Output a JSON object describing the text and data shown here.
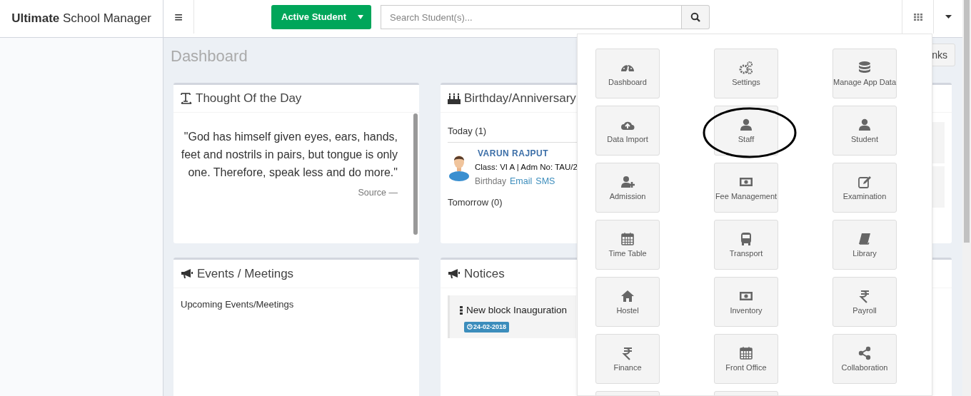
{
  "brand": {
    "bold": "Ultimate",
    "rest": "School Manager"
  },
  "header": {
    "menu_glyph": "≡",
    "status_button": "Active Student",
    "search": {
      "placeholder": "Search Student(s)..."
    }
  },
  "page_title": "Dashboard",
  "quick_button": "nks",
  "thought": {
    "title": "Thought Of the Day",
    "quote": "\"God has himself given eyes, ears, hands, feet and nostrils in pairs, but tongue is only one. Therefore, speak less and do more.\"",
    "source": "Source —"
  },
  "birthday": {
    "title": "Birthday/Anniversary",
    "today": "Today (1)",
    "person": {
      "name": "VARUN RAJPUT",
      "class_line": "Class: VI A | Adm No: TAU/2",
      "occasion": "Birthday",
      "links": [
        "Email",
        "SMS"
      ]
    },
    "tomorrow": "Tomorrow (0)"
  },
  "events": {
    "title": "Events / Meetings",
    "subtitle": "Upcoming Events/Meetings"
  },
  "notices": {
    "title": "Notices",
    "items": [
      {
        "title": "New block Inauguration",
        "date": "24-02-2018"
      }
    ]
  },
  "apps": [
    {
      "kind": "tile",
      "label": "Dashboard"
    },
    {
      "kind": "tile",
      "label": "Settings"
    },
    {
      "kind": "tile",
      "label": "Manage App Data"
    },
    {
      "kind": "tile",
      "label": "Data Import"
    },
    {
      "kind": "tile",
      "label": "Staff"
    },
    {
      "kind": "tile",
      "label": "Student"
    },
    {
      "kind": "tile",
      "label": "Admission"
    },
    {
      "kind": "tile",
      "label": "Fee Management"
    },
    {
      "kind": "tile",
      "label": "Examination"
    },
    {
      "kind": "tile",
      "label": "Time Table"
    },
    {
      "kind": "tile",
      "label": "Transport"
    },
    {
      "kind": "tile",
      "label": "Library"
    },
    {
      "kind": "tile",
      "label": "Hostel"
    },
    {
      "kind": "tile",
      "label": "Inventory"
    },
    {
      "kind": "tile",
      "label": "Payroll"
    },
    {
      "kind": "tile",
      "label": "Finance"
    },
    {
      "kind": "tile",
      "label": "Front Office"
    },
    {
      "kind": "tile",
      "label": "Collaboration"
    },
    {
      "kind": "cut"
    },
    {
      "kind": "cut"
    }
  ]
}
